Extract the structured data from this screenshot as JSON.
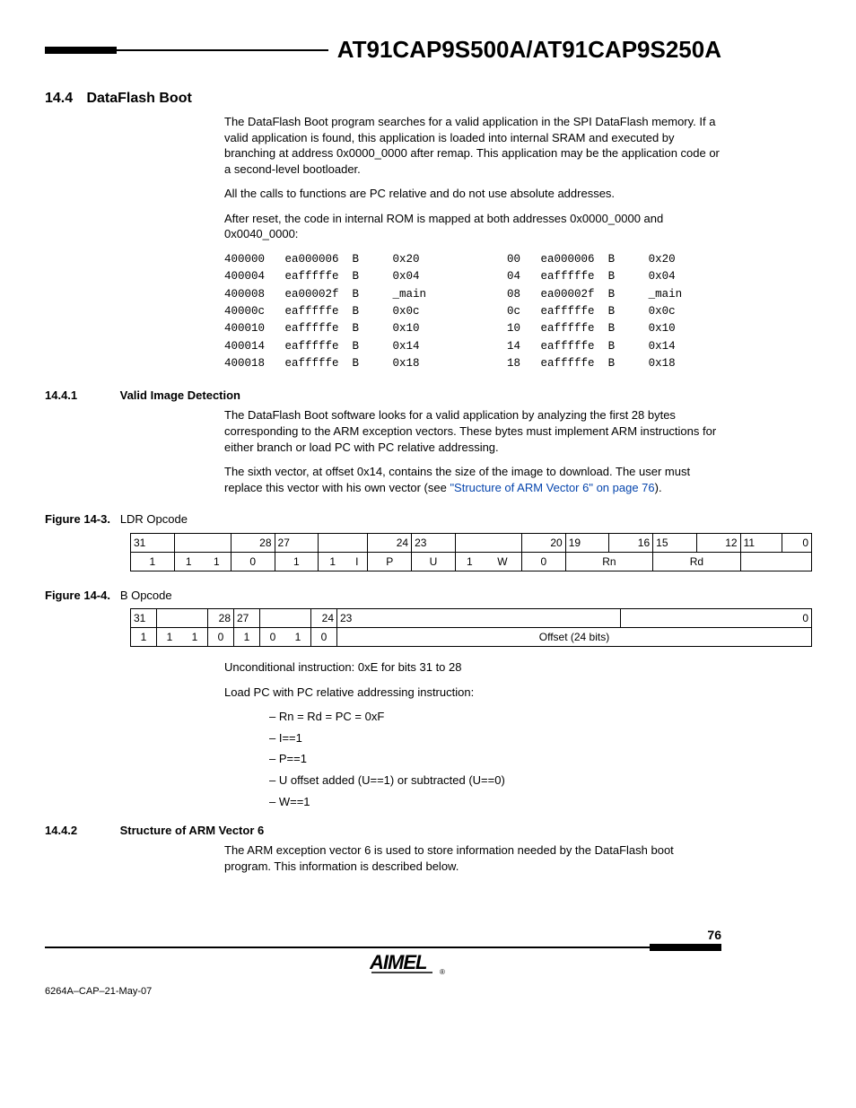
{
  "doc_title": "AT91CAP9S500A/AT91CAP9S250A",
  "section": {
    "num": "14.4",
    "title": "DataFlash Boot"
  },
  "para1": "The DataFlash Boot program searches for a valid application in the SPI DataFlash memory. If a valid application is found, this application is loaded into internal SRAM and executed by branching at address 0x0000_0000 after remap. This application may be the application code or a second-level bootloader.",
  "para2": "All the calls to functions are PC relative and do not use absolute addresses.",
  "para3": "After reset, the code in internal ROM is mapped at both addresses 0x0000_0000 and 0x0040_0000:",
  "code_left": "400000   ea000006  B     0x20\n400004   eafffffe  B     0x04\n400008   ea00002f  B     _main\n40000c   eafffffe  B     0x0c\n400010   eafffffe  B     0x10\n400014   eafffffe  B     0x14\n400018   eafffffe  B     0x18",
  "code_right": "00   ea000006  B     0x20\n04   eafffffe  B     0x04\n08   ea00002f  B     _main\n0c   eafffffe  B     0x0c\n10   eafffffe  B     0x10\n14   eafffffe  B     0x14\n18   eafffffe  B     0x18",
  "sub1": {
    "num": "14.4.1",
    "title": "Valid Image Detection"
  },
  "sub1_p1": "The DataFlash Boot software looks for a valid application by analyzing the first 28 bytes corresponding to the ARM exception vectors. These bytes must implement ARM instructions for either branch or load PC with PC relative addressing.",
  "sub1_p2a": "The sixth vector, at offset 0x14, contains the size of the image to download. The user must replace this vector with his own vector (see ",
  "sub1_p2_link": "\"Structure of ARM Vector 6\" on page 76",
  "sub1_p2b": ").",
  "fig3_label": "Figure 14-3.",
  "fig3_title": "LDR Opcode",
  "fig3": {
    "hdr": [
      "31",
      "",
      "",
      "28",
      "27",
      "",
      "",
      "24",
      "23",
      "",
      "",
      "20",
      "19",
      "",
      "",
      "16",
      "15",
      "",
      "",
      "12",
      "11",
      "",
      "",
      "",
      "",
      "",
      "",
      "",
      "",
      "",
      "",
      "0"
    ],
    "row": [
      "1",
      "1",
      "1",
      "0",
      "1",
      "1",
      "I",
      "P",
      "U",
      "1",
      "W",
      "0",
      "Rn",
      "Rd",
      ""
    ]
  },
  "fig4_label": "Figure 14-4.",
  "fig4_title": "B Opcode",
  "fig4": {
    "hdr": [
      "31",
      "",
      "",
      "28",
      "27",
      "",
      "",
      "24",
      "23",
      "",
      "",
      "",
      "",
      "",
      "",
      "",
      "",
      "",
      "",
      "",
      "",
      "",
      "",
      "",
      "",
      "",
      "",
      "",
      "",
      "",
      "",
      "0"
    ],
    "row": [
      "1",
      "1",
      "1",
      "0",
      "1",
      "0",
      "1",
      "0",
      "Offset (24 bits)"
    ]
  },
  "after_fig_p1": "Unconditional instruction: 0xE for bits 31 to 28",
  "after_fig_p2": "Load PC with PC relative addressing instruction:",
  "bullets": [
    "– Rn = Rd = PC = 0xF",
    "– I==1",
    "– P==1",
    "– U offset added (U==1) or subtracted (U==0)",
    "– W==1"
  ],
  "sub2": {
    "num": "14.4.2",
    "title": "Structure of ARM Vector 6"
  },
  "sub2_p1": "The ARM exception vector 6 is used to store information needed by the DataFlash boot program. This information is described below.",
  "footer_doc": "6264A–CAP–21-May-07",
  "page": "76",
  "logo_text": "AIMEL"
}
